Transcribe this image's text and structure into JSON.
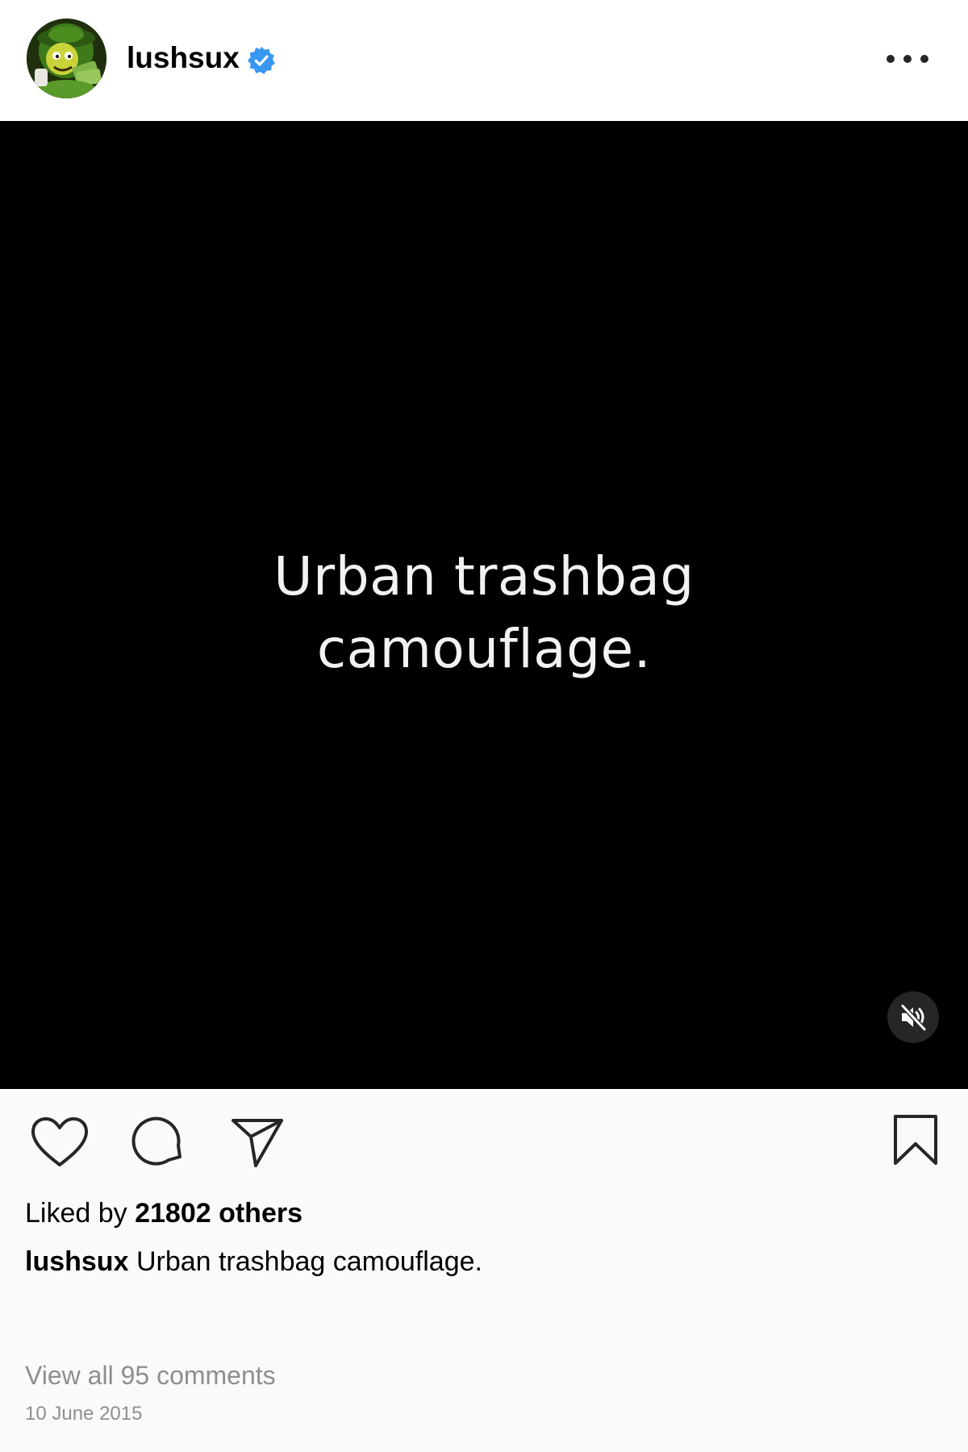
{
  "header": {
    "username": "lushsux",
    "verified_icon": "verified-badge-icon",
    "more_icon": "more-options-icon"
  },
  "media": {
    "text_line1": "Urban trashbag",
    "text_line2": "camouflage.",
    "mute_icon": "speaker-muted-icon"
  },
  "actions": {
    "like_icon": "heart-icon",
    "comment_icon": "comment-bubble-icon",
    "share_icon": "paper-plane-icon",
    "save_icon": "bookmark-icon"
  },
  "likes": {
    "prefix": "Liked by",
    "count_text": "21802 others"
  },
  "caption": {
    "username": "lushsux",
    "text": "Urban trashbag camouflage."
  },
  "comments": {
    "view_all_label": "View all 95 comments"
  },
  "date": "10 June 2015",
  "colors": {
    "verified_blue": "#3897f0",
    "muted_text": "#8e8e8e",
    "media_background": "#000000"
  }
}
